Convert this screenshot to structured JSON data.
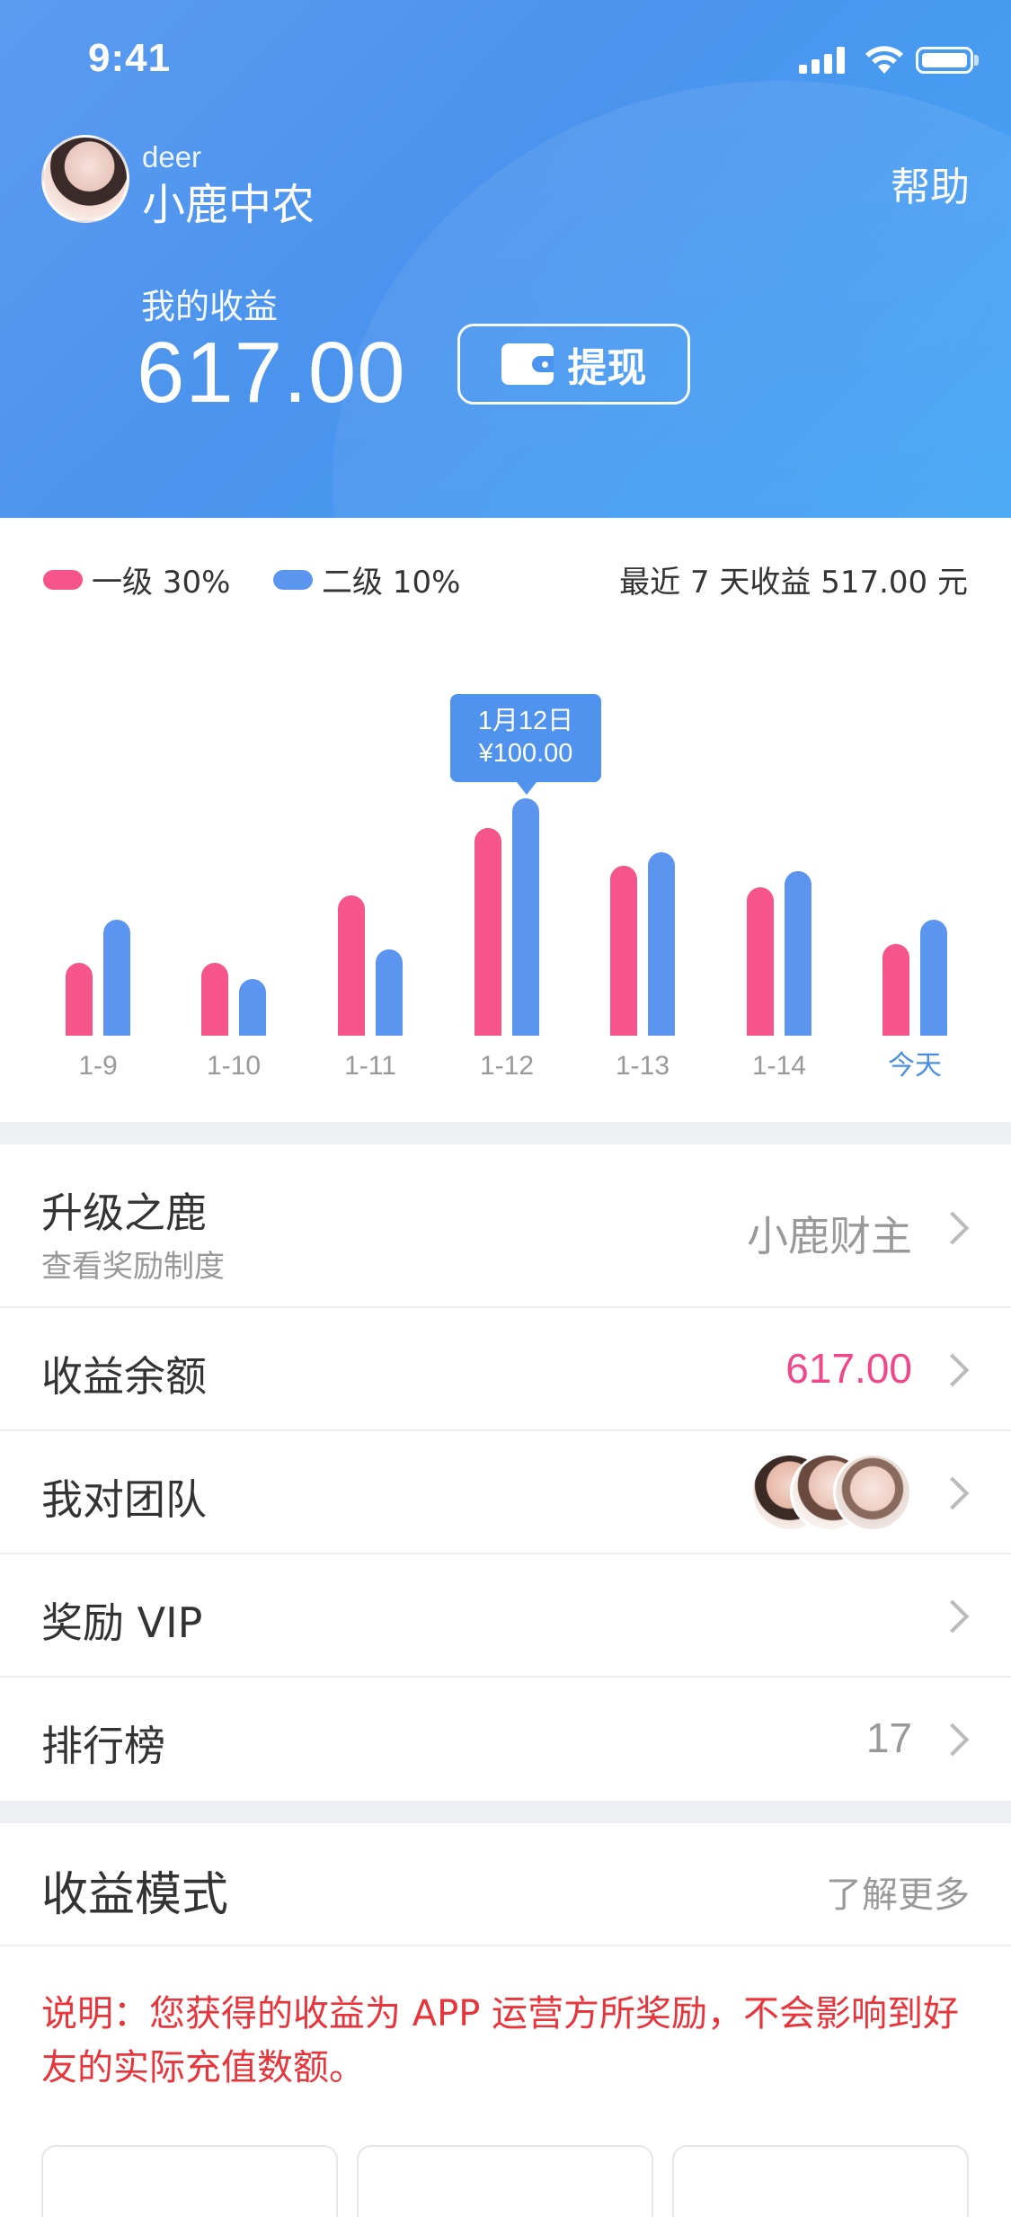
{
  "status_bar": {
    "time": "9:41"
  },
  "header": {
    "user_sub": "deer",
    "user_name": "小鹿中农",
    "help_label": "帮助",
    "earnings_label": "我的收益",
    "earnings_value": "617.00",
    "withdraw_label": "提现"
  },
  "legend": {
    "level1": "一级 30%",
    "level2": "二级 10%",
    "level1_color": "#f5558b",
    "level2_color": "#5b95ef",
    "recent_total": "最近 7 天收益 517.00 元"
  },
  "tooltip": {
    "date": "1月12日",
    "amount": "¥100.00"
  },
  "chart_data": {
    "type": "bar",
    "categories": [
      "1-9",
      "1-10",
      "1-11",
      "1-12",
      "1-13",
      "1-14",
      "今天"
    ],
    "series": [
      {
        "name": "一级 30%",
        "color": "#f5558b",
        "values": [
          27,
          27,
          52,
          77,
          63,
          55,
          34
        ]
      },
      {
        "name": "二级 10%",
        "color": "#5b95ef",
        "values": [
          43,
          21,
          32,
          88,
          68,
          61,
          43
        ]
      }
    ],
    "ylim": [
      0,
      100
    ],
    "highlight_category": "今天",
    "highlight_color": "#4a90e2"
  },
  "list": {
    "upgrade": {
      "title": "升级之鹿",
      "subtitle": "查看奖励制度",
      "value": "小鹿财主"
    },
    "balance": {
      "title": "收益余额",
      "value": "617.00",
      "value_color": "#f0478a"
    },
    "team": {
      "title": "我对团队"
    },
    "vip": {
      "title": "奖励 VIP"
    },
    "ranking": {
      "title": "排行榜",
      "value": "17"
    }
  },
  "mode": {
    "title": "收益模式",
    "more_label": "了解更多",
    "note": "说明：您获得的收益为 APP 运营方所奖励，不会影响到好友的实际充值数额。"
  }
}
